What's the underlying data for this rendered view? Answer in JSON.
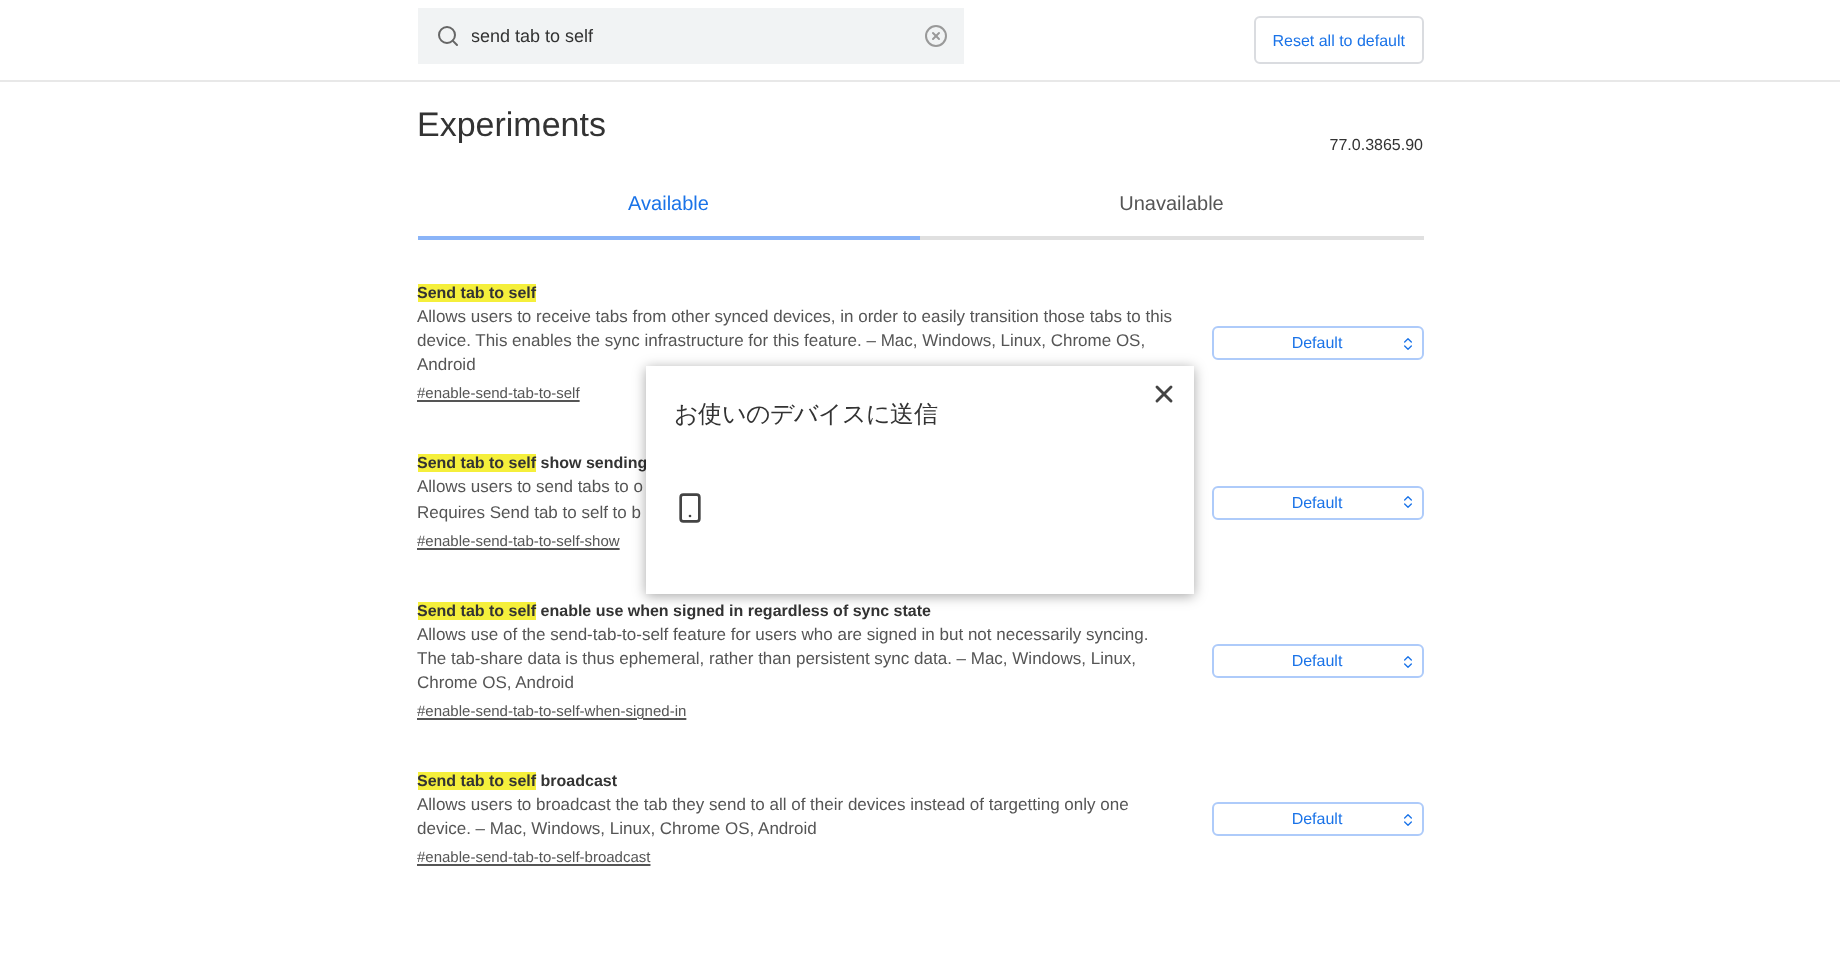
{
  "search": {
    "value": "send tab to self"
  },
  "reset_button": "Reset all to default",
  "heading": "Experiments",
  "version": "77.0.3865.90",
  "tabs": [
    {
      "label": "Available",
      "selected": true
    },
    {
      "label": "Unavailable",
      "selected": false
    }
  ],
  "experiments": [
    {
      "highlight": "Send tab to self",
      "description_lines": [
        "Allows users to receive tabs from other synced devices, in order to easily transition those tabs to this device. This enables the sync infrastructure for this feature. – Mac, Windows, Linux, Chrome OS, Android"
      ],
      "link": "#enable-send-tab-to-self",
      "select": "Default"
    },
    {
      "highlight": "Send tab to self",
      "rest": " show sending",
      "description_lines": [
        "Allows users to send tabs to o",
        "Requires Send tab to self to b"
      ],
      "link": "#enable-send-tab-to-self-show",
      "select": "Default"
    },
    {
      "highlight": "Send tab to self",
      "rest": " enable use when signed in regardless of sync state",
      "description_lines": [
        "Allows use of the send-tab-to-self feature for users who are signed in but not necessarily syncing. The tab-share data is thus ephemeral, rather than persistent sync data. – Mac, Windows, Linux, Chrome OS, Android"
      ],
      "link": "#enable-send-tab-to-self-when-signed-in",
      "select": "Default"
    },
    {
      "highlight": "Send tab to self",
      "rest": " broadcast",
      "description_lines": [
        "Allows users to broadcast the tab they send to all of their devices instead of targetting only one device. – Mac, Windows, Linux, Chrome OS, Android"
      ],
      "link": "#enable-send-tab-to-self-broadcast",
      "select": "Default"
    }
  ],
  "dialog": {
    "title": "お使いのデバイスに送信"
  }
}
